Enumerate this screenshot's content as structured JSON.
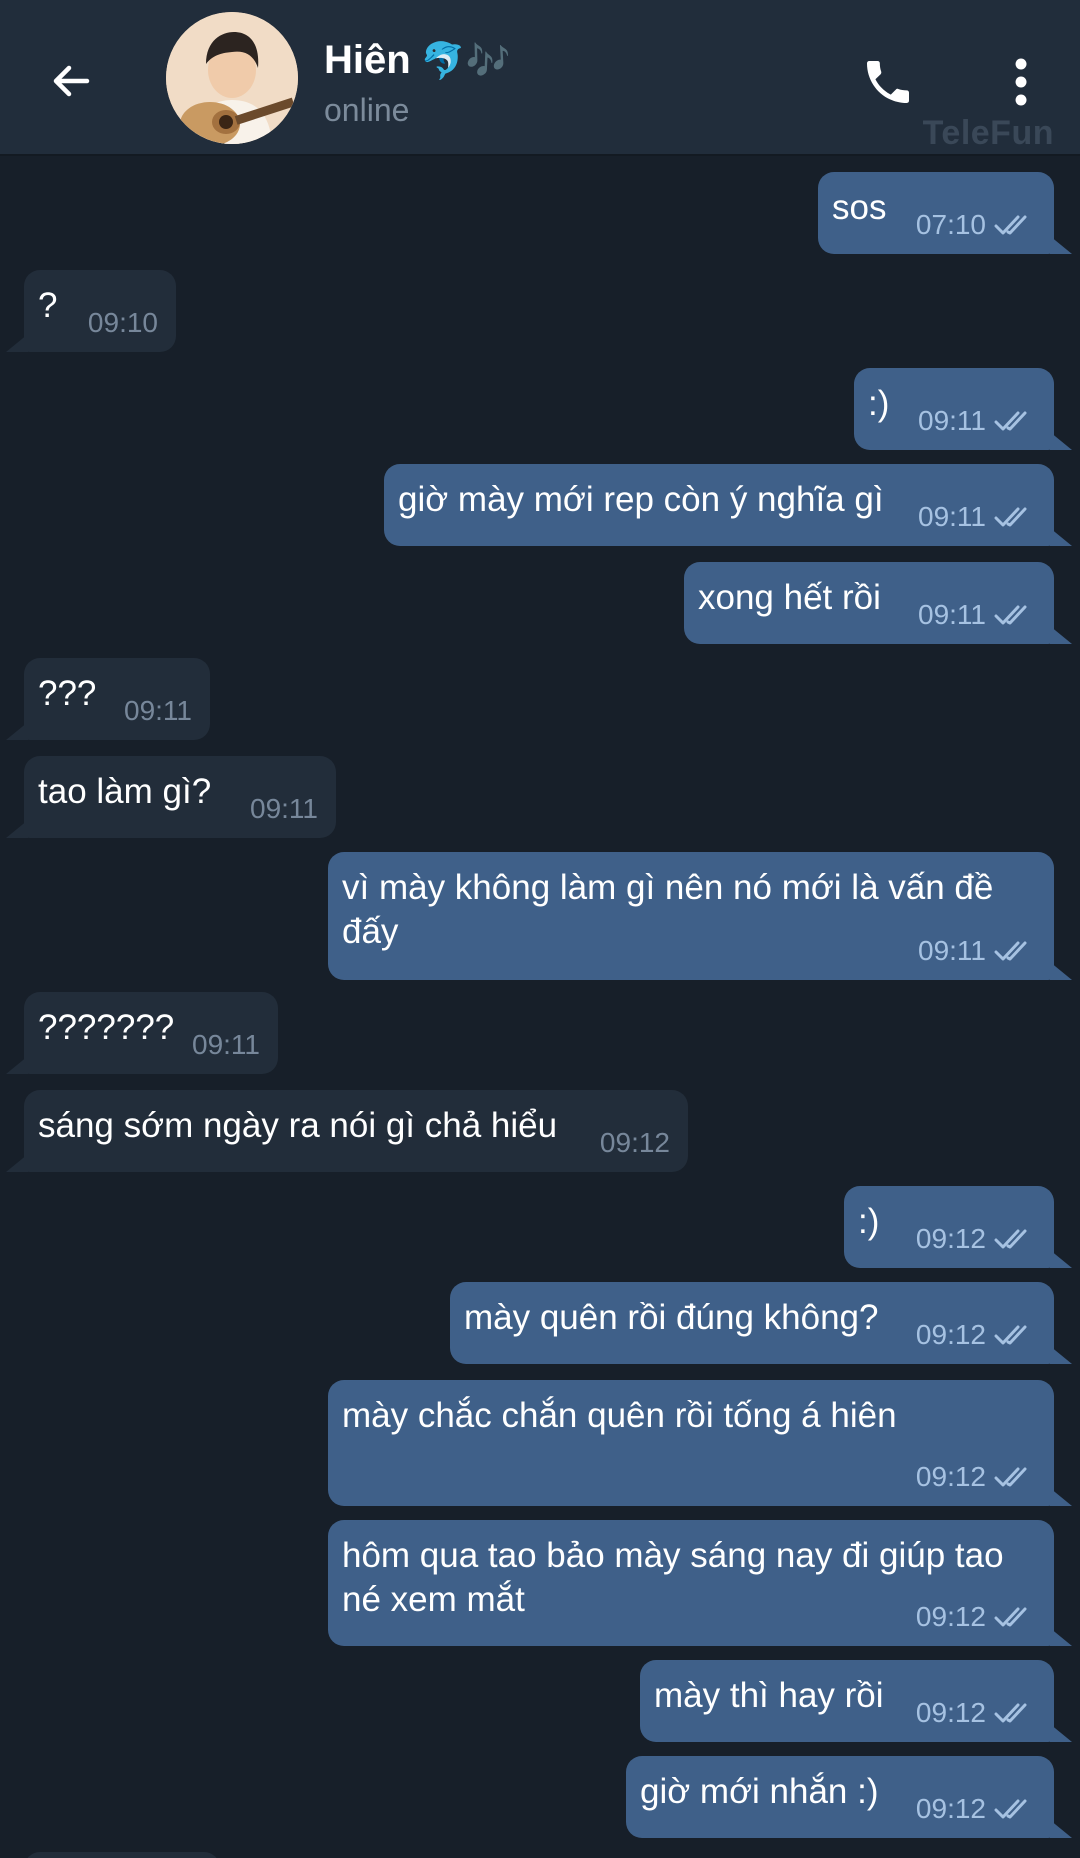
{
  "header": {
    "contact_name": "Hiên",
    "name_emoji": "🐬🎶",
    "status": "online",
    "watermark": "TeleFun"
  },
  "messages": [
    {
      "dir": "out",
      "text": "sos",
      "time": "07:10",
      "read": true
    },
    {
      "dir": "in",
      "text": "?",
      "time": "09:10"
    },
    {
      "dir": "out",
      "text": ":)",
      "time": "09:11",
      "read": true
    },
    {
      "dir": "out",
      "text": "giờ mày mới rep còn ý nghĩa gì",
      "time": "09:11",
      "read": true
    },
    {
      "dir": "out",
      "text": "xong hết rồi",
      "time": "09:11",
      "read": true
    },
    {
      "dir": "in",
      "text": "???",
      "time": "09:11"
    },
    {
      "dir": "in",
      "text": "tao làm gì?",
      "time": "09:11"
    },
    {
      "dir": "out",
      "text": "vì mày không làm gì nên nó mới là vấn đề đấy",
      "time": "09:11",
      "read": true
    },
    {
      "dir": "in",
      "text": "???????",
      "time": "09:11"
    },
    {
      "dir": "in",
      "text": "sáng sớm ngày ra nói gì chả hiểu",
      "time": "09:12"
    },
    {
      "dir": "out",
      "text": ":)",
      "time": "09:12",
      "read": true
    },
    {
      "dir": "out",
      "text": "mày quên rồi đúng không?",
      "time": "09:12",
      "read": true
    },
    {
      "dir": "out",
      "text": "mày chắc chắn quên rồi tống á hiên",
      "time": "09:12",
      "read": true
    },
    {
      "dir": "out",
      "text": "hôm qua tao bảo mày sáng nay đi giúp tao né xem mắt",
      "time": "09:12",
      "read": true
    },
    {
      "dir": "out",
      "text": "mày thì hay rồi",
      "time": "09:12",
      "read": true
    },
    {
      "dir": "out",
      "text": "giờ mới nhắn :)",
      "time": "09:12",
      "read": true
    }
  ]
}
